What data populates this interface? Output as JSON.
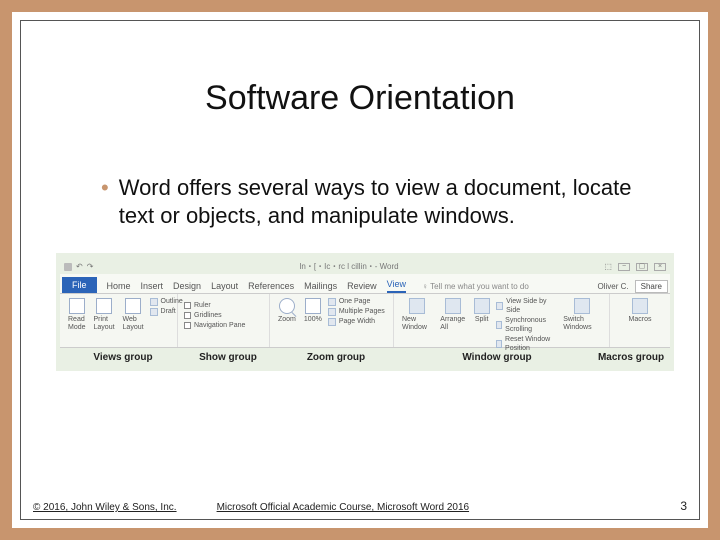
{
  "slide": {
    "title": "Software Orientation",
    "bullet": "Word offers several ways to view a document, locate text or objects, and manipulate windows."
  },
  "ribbon": {
    "window_title": "In・[・Ic・rc l cillin・- Word",
    "user": "Oliver C.",
    "share": "Share",
    "tabs": {
      "file": "File",
      "home": "Home",
      "insert": "Insert",
      "design": "Design",
      "layout": "Layout",
      "references": "References",
      "mailings": "Mailings",
      "review": "Review",
      "view": "View",
      "tell_me": "♀ Tell me what you want to do"
    },
    "views": {
      "read": "Read Mode",
      "print": "Print Layout",
      "web": "Web Layout",
      "outline": "Outline",
      "draft": "Draft"
    },
    "show": {
      "ruler": "Ruler",
      "gridlines": "Gridlines",
      "nav": "Navigation Pane"
    },
    "zoom": {
      "zoom": "Zoom",
      "hundred": "100%",
      "one_page": "One Page",
      "multi": "Multiple Pages",
      "width": "Page Width"
    },
    "window": {
      "neww": "New Window",
      "arrange": "Arrange All",
      "split": "Split",
      "side": "View Side by Side",
      "sync": "Synchronous Scrolling",
      "reset": "Reset Window Position",
      "switch": "Switch Windows"
    },
    "macros": {
      "macros": "Macros"
    },
    "group_labels": {
      "views": "Views group",
      "show": "Show group",
      "zoom": "Zoom group",
      "window": "Window group",
      "macros": "Macros group"
    }
  },
  "footer": {
    "copyright": "© 2016, John Wiley & Sons, Inc.",
    "course": "Microsoft Official Academic Course, Microsoft Word 2016",
    "page": "3"
  }
}
